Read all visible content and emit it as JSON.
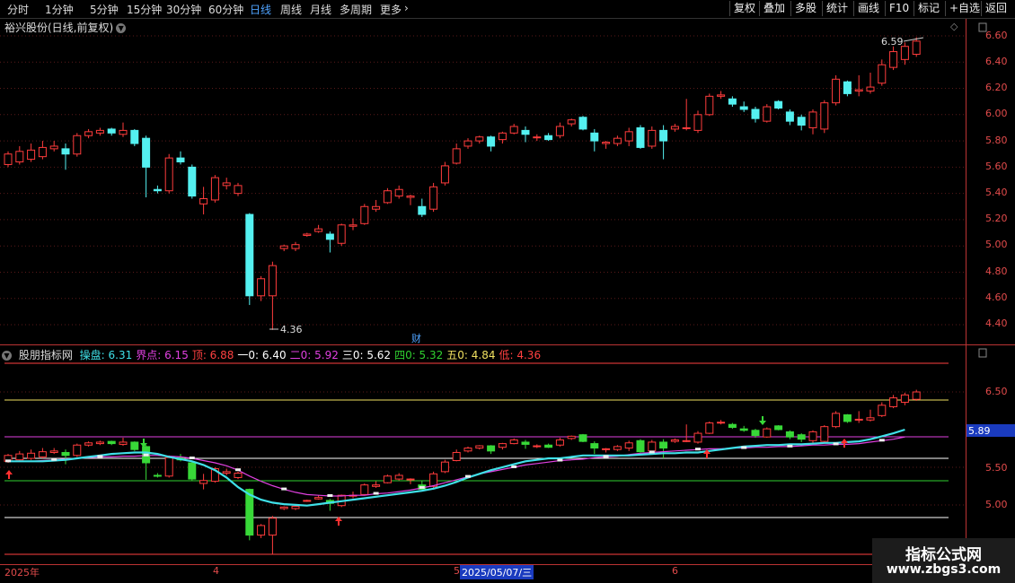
{
  "toolbar": {
    "timeframes": [
      "分时",
      "1分钟",
      "5分钟",
      "15分钟",
      "30分钟",
      "60分钟",
      "日线",
      "周线",
      "月线",
      "多周期",
      "更多"
    ],
    "active_timeframe": "日线",
    "more_icon": "chevron-right-icon",
    "right_buttons": [
      "复权",
      "叠加",
      "多股",
      "统计",
      "画线",
      "F10",
      "标记",
      "+自选",
      "返回"
    ]
  },
  "main": {
    "title": "裕兴股份(日线,前复权)",
    "high_label": "6.59",
    "low_label": "4.36",
    "finance_marker": "财",
    "y_axis": [
      "6.60",
      "6.40",
      "6.20",
      "6.00",
      "5.80",
      "5.60",
      "5.40",
      "5.20",
      "5.00",
      "4.80",
      "4.60",
      "4.40"
    ]
  },
  "indicator": {
    "name": "股朋指标网",
    "fields": [
      {
        "label": "操盘:",
        "value": "6.31",
        "color": "#3fe0e8"
      },
      {
        "label": "界点:",
        "value": "6.15",
        "color": "#e040e0"
      },
      {
        "label": "顶:",
        "value": "6.88",
        "color": "#ff4040"
      },
      {
        "label": "一0:",
        "value": "6.40",
        "color": "#ffffff"
      },
      {
        "label": "二0:",
        "value": "5.92",
        "color": "#e040e0"
      },
      {
        "label": "三0:",
        "value": "5.62",
        "color": "#ffffff"
      },
      {
        "label": "四0:",
        "value": "5.32",
        "color": "#30d030"
      },
      {
        "label": "五0:",
        "value": "4.84",
        "color": "#f0e060"
      },
      {
        "label": "低:",
        "value": "4.36",
        "color": "#ff4040"
      }
    ],
    "y_axis": [
      "6.50",
      "5.50",
      "5.00"
    ],
    "current_value": "5.89"
  },
  "dates": {
    "year": "2025年",
    "m4": "4",
    "m5": "5",
    "selected": "2025/05/07/三",
    "m6": "6"
  },
  "watermark": {
    "line1": "指标公式网",
    "line2": "www.zbgs3.com"
  },
  "colors": {
    "up": "#ff3c3c",
    "down": "#54f0f0",
    "ind_down": "#38d838",
    "line_cyan": "#3fe0e8",
    "line_magenta": "#e040e0"
  },
  "chart_data": {
    "type": "candlestick",
    "title": "裕兴股份(日线,前复权)",
    "ylim": [
      4.3,
      6.7
    ],
    "candles": [
      {
        "o": 5.62,
        "h": 5.72,
        "l": 5.6,
        "c": 5.7
      },
      {
        "o": 5.64,
        "h": 5.76,
        "l": 5.62,
        "c": 5.72
      },
      {
        "o": 5.66,
        "h": 5.78,
        "l": 5.64,
        "c": 5.73
      },
      {
        "o": 5.68,
        "h": 5.8,
        "l": 5.66,
        "c": 5.75
      },
      {
        "o": 5.74,
        "h": 5.8,
        "l": 5.72,
        "c": 5.76
      },
      {
        "o": 5.74,
        "h": 5.78,
        "l": 5.58,
        "c": 5.7
      },
      {
        "o": 5.7,
        "h": 5.86,
        "l": 5.68,
        "c": 5.84
      },
      {
        "o": 5.84,
        "h": 5.89,
        "l": 5.82,
        "c": 5.87
      },
      {
        "o": 5.86,
        "h": 5.9,
        "l": 5.84,
        "c": 5.88
      },
      {
        "o": 5.89,
        "h": 5.9,
        "l": 5.84,
        "c": 5.86
      },
      {
        "o": 5.85,
        "h": 5.94,
        "l": 5.83,
        "c": 5.88
      },
      {
        "o": 5.88,
        "h": 5.89,
        "l": 5.76,
        "c": 5.78
      },
      {
        "o": 5.82,
        "h": 5.84,
        "l": 5.37,
        "c": 5.6
      },
      {
        "o": 5.43,
        "h": 5.46,
        "l": 5.4,
        "c": 5.42
      },
      {
        "o": 5.42,
        "h": 5.7,
        "l": 5.4,
        "c": 5.67
      },
      {
        "o": 5.67,
        "h": 5.72,
        "l": 5.62,
        "c": 5.64
      },
      {
        "o": 5.6,
        "h": 5.62,
        "l": 5.36,
        "c": 5.38
      },
      {
        "o": 5.32,
        "h": 5.45,
        "l": 5.24,
        "c": 5.36
      },
      {
        "o": 5.35,
        "h": 5.54,
        "l": 5.33,
        "c": 5.52
      },
      {
        "o": 5.46,
        "h": 5.52,
        "l": 5.43,
        "c": 5.48
      },
      {
        "o": 5.4,
        "h": 5.48,
        "l": 5.38,
        "c": 5.46
      },
      {
        "o": 5.24,
        "h": 5.25,
        "l": 4.55,
        "c": 4.62
      },
      {
        "o": 4.62,
        "h": 4.77,
        "l": 4.58,
        "c": 4.75
      },
      {
        "o": 4.62,
        "h": 4.88,
        "l": 4.36,
        "c": 4.85
      },
      {
        "o": 4.98,
        "h": 5.01,
        "l": 4.96,
        "c": 5.0
      },
      {
        "o": 4.98,
        "h": 5.03,
        "l": 4.96,
        "c": 5.01
      },
      {
        "o": 5.08,
        "h": 5.1,
        "l": 5.07,
        "c": 5.09
      },
      {
        "o": 5.11,
        "h": 5.16,
        "l": 5.1,
        "c": 5.13
      },
      {
        "o": 5.09,
        "h": 5.11,
        "l": 4.95,
        "c": 5.05
      },
      {
        "o": 5.02,
        "h": 5.17,
        "l": 5.0,
        "c": 5.16
      },
      {
        "o": 5.15,
        "h": 5.21,
        "l": 5.12,
        "c": 5.16
      },
      {
        "o": 5.17,
        "h": 5.32,
        "l": 5.16,
        "c": 5.3
      },
      {
        "o": 5.28,
        "h": 5.35,
        "l": 5.26,
        "c": 5.3
      },
      {
        "o": 5.33,
        "h": 5.44,
        "l": 5.32,
        "c": 5.42
      },
      {
        "o": 5.38,
        "h": 5.46,
        "l": 5.36,
        "c": 5.43
      },
      {
        "o": 5.37,
        "h": 5.39,
        "l": 5.31,
        "c": 5.38
      },
      {
        "o": 5.3,
        "h": 5.36,
        "l": 5.22,
        "c": 5.24
      },
      {
        "o": 5.28,
        "h": 5.48,
        "l": 5.26,
        "c": 5.45
      },
      {
        "o": 5.48,
        "h": 5.64,
        "l": 5.46,
        "c": 5.61
      },
      {
        "o": 5.63,
        "h": 5.78,
        "l": 5.62,
        "c": 5.74
      },
      {
        "o": 5.76,
        "h": 5.82,
        "l": 5.74,
        "c": 5.8
      },
      {
        "o": 5.8,
        "h": 5.84,
        "l": 5.78,
        "c": 5.83
      },
      {
        "o": 5.83,
        "h": 5.84,
        "l": 5.72,
        "c": 5.76
      },
      {
        "o": 5.81,
        "h": 5.87,
        "l": 5.78,
        "c": 5.86
      },
      {
        "o": 5.86,
        "h": 5.93,
        "l": 5.85,
        "c": 5.91
      },
      {
        "o": 5.88,
        "h": 5.91,
        "l": 5.79,
        "c": 5.85
      },
      {
        "o": 5.83,
        "h": 5.85,
        "l": 5.8,
        "c": 5.83
      },
      {
        "o": 5.84,
        "h": 5.86,
        "l": 5.8,
        "c": 5.81
      },
      {
        "o": 5.84,
        "h": 5.94,
        "l": 5.82,
        "c": 5.91
      },
      {
        "o": 5.93,
        "h": 5.97,
        "l": 5.91,
        "c": 5.96
      },
      {
        "o": 5.98,
        "h": 5.99,
        "l": 5.88,
        "c": 5.89
      },
      {
        "o": 5.86,
        "h": 5.89,
        "l": 5.72,
        "c": 5.8
      },
      {
        "o": 5.78,
        "h": 5.8,
        "l": 5.74,
        "c": 5.79
      },
      {
        "o": 5.78,
        "h": 5.84,
        "l": 5.76,
        "c": 5.82
      },
      {
        "o": 5.8,
        "h": 5.9,
        "l": 5.76,
        "c": 5.87
      },
      {
        "o": 5.9,
        "h": 5.92,
        "l": 5.74,
        "c": 5.75
      },
      {
        "o": 5.76,
        "h": 5.91,
        "l": 5.74,
        "c": 5.88
      },
      {
        "o": 5.88,
        "h": 5.92,
        "l": 5.66,
        "c": 5.8
      },
      {
        "o": 5.89,
        "h": 5.93,
        "l": 5.87,
        "c": 5.91
      },
      {
        "o": 5.9,
        "h": 6.12,
        "l": 5.88,
        "c": 5.9
      },
      {
        "o": 5.88,
        "h": 6.03,
        "l": 5.86,
        "c": 6.0
      },
      {
        "o": 6.0,
        "h": 6.16,
        "l": 5.99,
        "c": 6.14
      },
      {
        "o": 6.14,
        "h": 6.18,
        "l": 6.12,
        "c": 6.15
      },
      {
        "o": 6.12,
        "h": 6.14,
        "l": 6.06,
        "c": 6.08
      },
      {
        "o": 6.06,
        "h": 6.1,
        "l": 6.02,
        "c": 6.04
      },
      {
        "o": 6.04,
        "h": 6.06,
        "l": 5.94,
        "c": 5.97
      },
      {
        "o": 5.95,
        "h": 6.08,
        "l": 5.94,
        "c": 6.06
      },
      {
        "o": 6.1,
        "h": 6.11,
        "l": 6.04,
        "c": 6.05
      },
      {
        "o": 6.02,
        "h": 6.04,
        "l": 5.92,
        "c": 5.95
      },
      {
        "o": 5.98,
        "h": 6.0,
        "l": 5.88,
        "c": 5.92
      },
      {
        "o": 5.9,
        "h": 6.04,
        "l": 5.85,
        "c": 6.02
      },
      {
        "o": 5.89,
        "h": 6.11,
        "l": 5.86,
        "c": 6.09
      },
      {
        "o": 6.09,
        "h": 6.3,
        "l": 6.07,
        "c": 6.27
      },
      {
        "o": 6.25,
        "h": 6.26,
        "l": 6.14,
        "c": 6.16
      },
      {
        "o": 6.18,
        "h": 6.3,
        "l": 6.14,
        "c": 6.19
      },
      {
        "o": 6.18,
        "h": 6.32,
        "l": 6.16,
        "c": 6.21
      },
      {
        "o": 6.24,
        "h": 6.42,
        "l": 6.22,
        "c": 6.38
      },
      {
        "o": 6.36,
        "h": 6.52,
        "l": 6.34,
        "c": 6.48
      },
      {
        "o": 6.42,
        "h": 6.55,
        "l": 6.38,
        "c": 6.52
      },
      {
        "o": 6.46,
        "h": 6.59,
        "l": 6.44,
        "c": 6.56
      }
    ],
    "indicator_series": {
      "operate": [
        5.62,
        5.62,
        5.62,
        5.62,
        5.63,
        5.64,
        5.66,
        5.68,
        5.7,
        5.72,
        5.73,
        5.74,
        5.74,
        5.72,
        5.68,
        5.65,
        5.62,
        5.57,
        5.5,
        5.4,
        5.27,
        5.17,
        5.1,
        5.06,
        5.04,
        5.03,
        5.02,
        5.04,
        5.06,
        5.08,
        5.1,
        5.12,
        5.14,
        5.16,
        5.18,
        5.2,
        5.22,
        5.25,
        5.29,
        5.34,
        5.4,
        5.45,
        5.5,
        5.54,
        5.58,
        5.62,
        5.64,
        5.66,
        5.66,
        5.68,
        5.7,
        5.7,
        5.7,
        5.7,
        5.7,
        5.71,
        5.72,
        5.73,
        5.73,
        5.74,
        5.74,
        5.76,
        5.78,
        5.8,
        5.82,
        5.83,
        5.84,
        5.84,
        5.85,
        5.85,
        5.86,
        5.87,
        5.87,
        5.88,
        5.89,
        5.92,
        5.96,
        6.0,
        6.05
      ],
      "boundary": [
        5.62,
        5.62,
        5.62,
        5.63,
        5.64,
        5.65,
        5.66,
        5.67,
        5.68,
        5.68,
        5.69,
        5.69,
        5.7,
        5.7,
        5.69,
        5.68,
        5.66,
        5.63,
        5.6,
        5.56,
        5.5,
        5.42,
        5.35,
        5.29,
        5.24,
        5.2,
        5.17,
        5.16,
        5.15,
        5.15,
        5.16,
        5.16,
        5.18,
        5.19,
        5.21,
        5.23,
        5.26,
        5.29,
        5.33,
        5.37,
        5.41,
        5.45,
        5.48,
        5.51,
        5.54,
        5.57,
        5.59,
        5.61,
        5.63,
        5.64,
        5.65,
        5.67,
        5.68,
        5.69,
        5.71,
        5.73,
        5.74,
        5.75,
        5.76,
        5.77,
        5.78,
        5.79,
        5.79,
        5.8,
        5.8,
        5.81,
        5.81,
        5.82,
        5.82,
        5.83,
        5.84,
        5.84,
        5.85,
        5.85,
        5.86,
        5.88,
        5.9,
        5.92,
        5.95
      ]
    },
    "indicator_levels": {
      "top": 6.88,
      "one": 6.4,
      "two": 5.92,
      "three": 5.62,
      "four": 5.32,
      "five": 4.84,
      "low": 4.36
    }
  }
}
